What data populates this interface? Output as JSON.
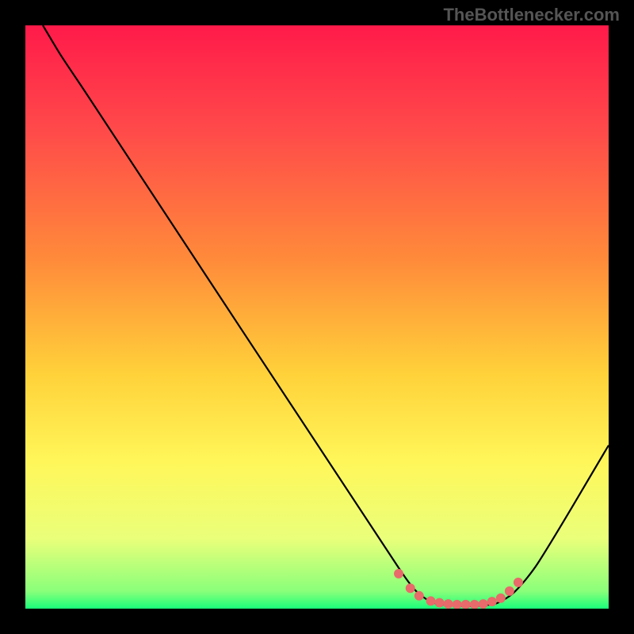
{
  "watermark": "TheBottlenecker.com",
  "chart_data": {
    "type": "line",
    "title": "",
    "xlabel": "",
    "ylabel": "",
    "xlim": [
      0,
      100
    ],
    "ylim": [
      0,
      100
    ],
    "grid": false,
    "background_gradient": {
      "stops": [
        {
          "offset": 0,
          "color": "#ff1a4a"
        },
        {
          "offset": 18,
          "color": "#ff4a4a"
        },
        {
          "offset": 40,
          "color": "#ff8a3a"
        },
        {
          "offset": 60,
          "color": "#ffd23a"
        },
        {
          "offset": 75,
          "color": "#fff75a"
        },
        {
          "offset": 88,
          "color": "#eaff7a"
        },
        {
          "offset": 97,
          "color": "#8aff7a"
        },
        {
          "offset": 100,
          "color": "#1aff7a"
        }
      ]
    },
    "series": [
      {
        "name": "bottleneck-curve",
        "color": "#000000",
        "points": [
          {
            "x": 3,
            "y": 100
          },
          {
            "x": 6,
            "y": 95
          },
          {
            "x": 10,
            "y": 89
          },
          {
            "x": 64,
            "y": 7
          },
          {
            "x": 67,
            "y": 3
          },
          {
            "x": 70,
            "y": 1
          },
          {
            "x": 74,
            "y": 0.5
          },
          {
            "x": 78,
            "y": 0.5
          },
          {
            "x": 81,
            "y": 1
          },
          {
            "x": 84,
            "y": 3
          },
          {
            "x": 88,
            "y": 8
          },
          {
            "x": 100,
            "y": 28
          }
        ]
      }
    ],
    "markers": {
      "name": "optimal-range-markers",
      "color": "#e86a6a",
      "radius": 6,
      "points": [
        {
          "x": 64,
          "y": 6
        },
        {
          "x": 66,
          "y": 3.5
        },
        {
          "x": 67.5,
          "y": 2.2
        },
        {
          "x": 69.5,
          "y": 1.3
        },
        {
          "x": 71,
          "y": 1.0
        },
        {
          "x": 72.5,
          "y": 0.8
        },
        {
          "x": 74,
          "y": 0.7
        },
        {
          "x": 75.5,
          "y": 0.7
        },
        {
          "x": 77,
          "y": 0.7
        },
        {
          "x": 78.5,
          "y": 0.8
        },
        {
          "x": 80,
          "y": 1.2
        },
        {
          "x": 81.5,
          "y": 1.8
        },
        {
          "x": 83,
          "y": 3.0
        },
        {
          "x": 84.5,
          "y": 4.5
        }
      ]
    }
  }
}
